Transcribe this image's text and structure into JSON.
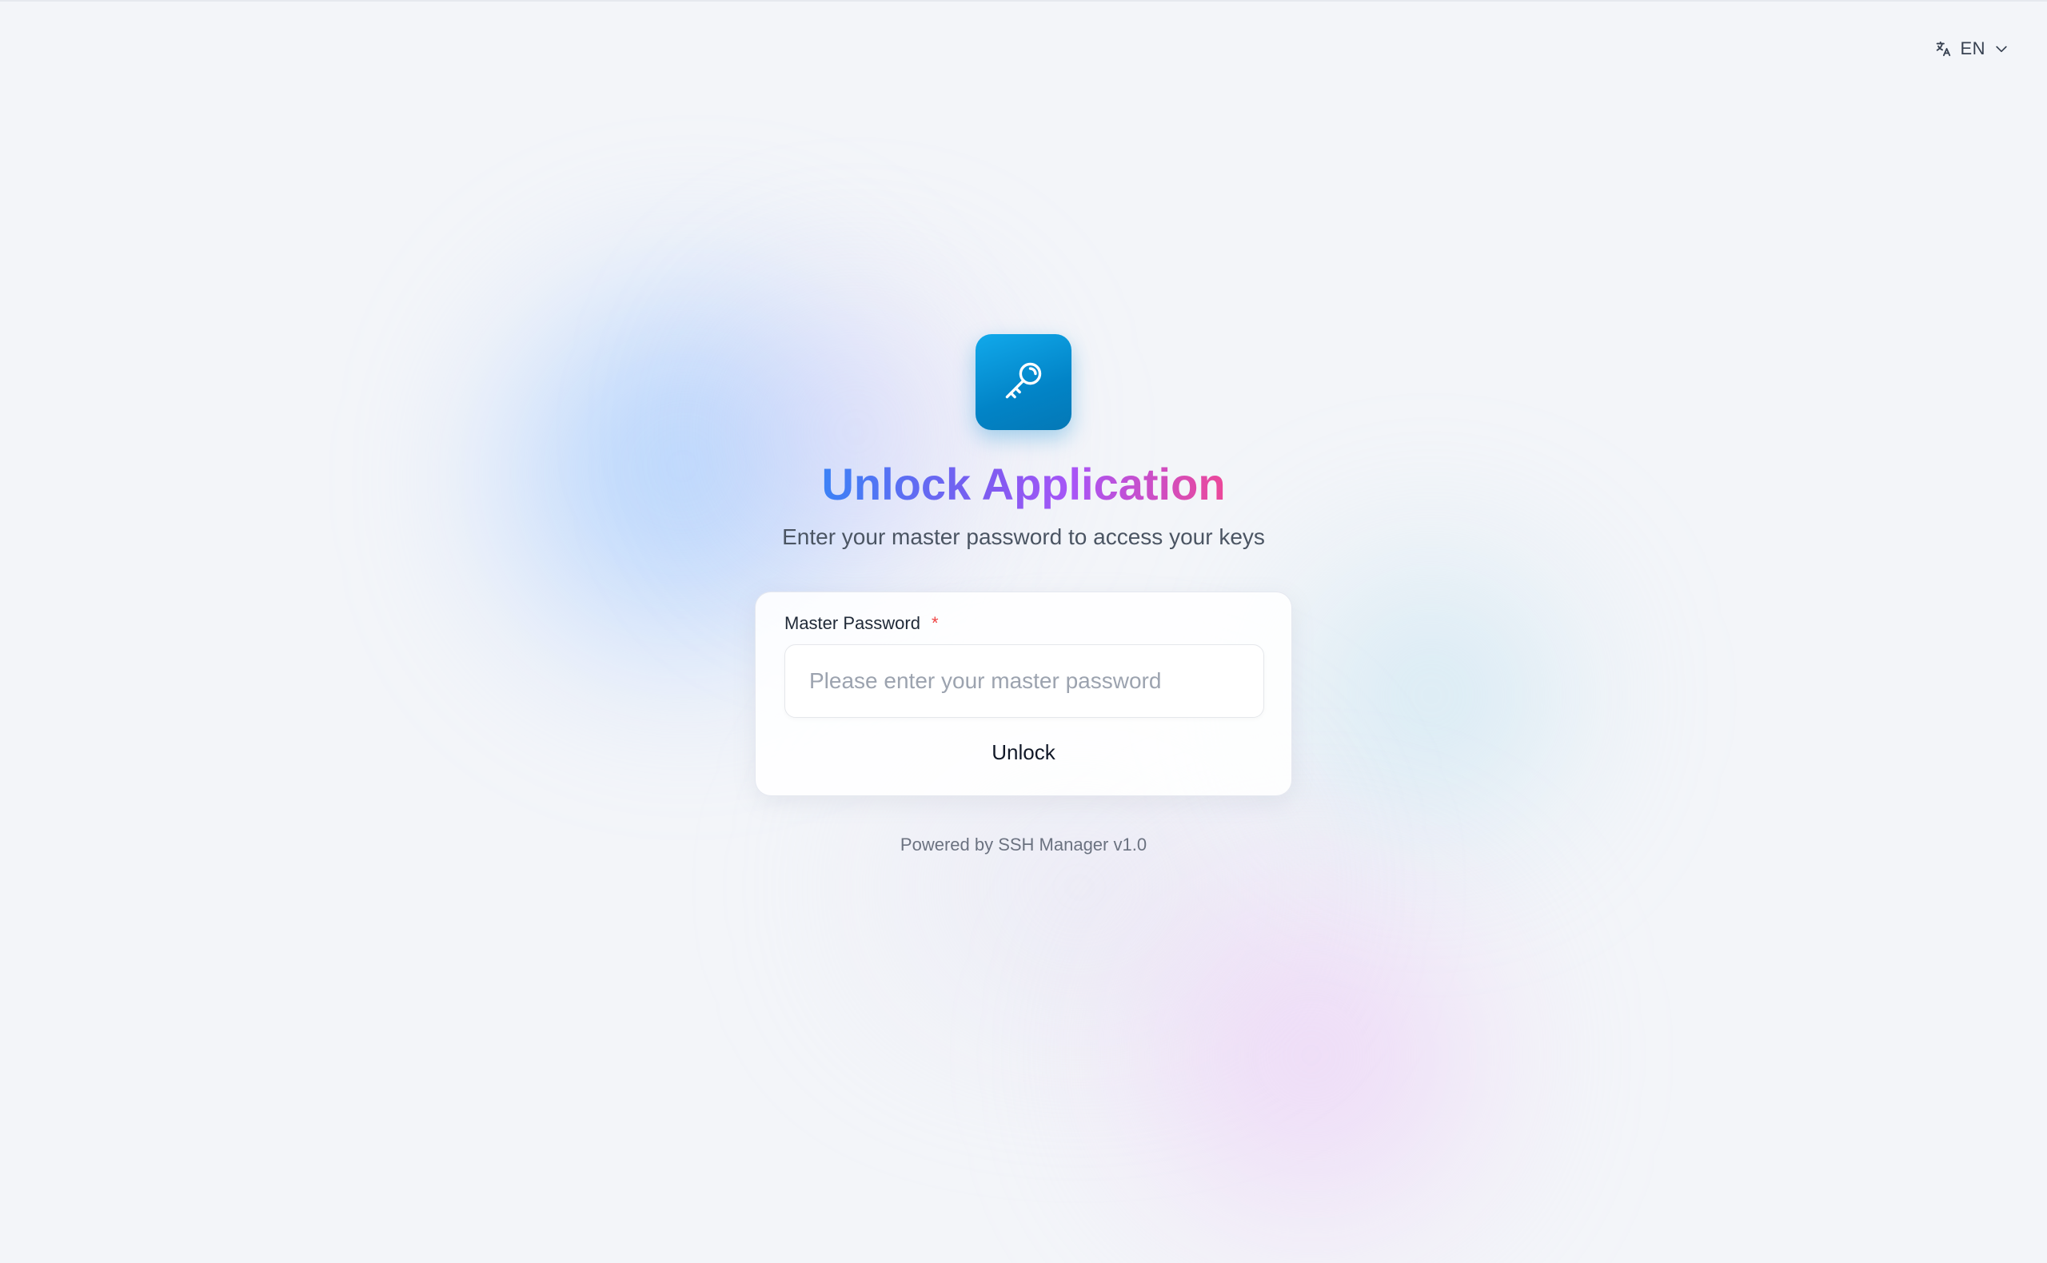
{
  "header": {
    "language": {
      "code": "EN",
      "icon": "translate-icon",
      "dropdown_icon": "chevron-down-icon"
    }
  },
  "app_icon": {
    "icon": "key-icon",
    "color": "#0ea5e9"
  },
  "title": "Unlock Application",
  "subtitle": "Enter your master password to access your keys",
  "form": {
    "password_label": "Master Password",
    "required_mark": "*",
    "password_placeholder": "Please enter your master password",
    "password_value": "",
    "unlock_label": "Unlock"
  },
  "footer": "Powered by SSH Manager v1.0",
  "colors": {
    "title_gradient": [
      "#3b82f6",
      "#a855f7",
      "#ec4899"
    ],
    "required": "#ef4444",
    "accent": "#0284c7"
  }
}
